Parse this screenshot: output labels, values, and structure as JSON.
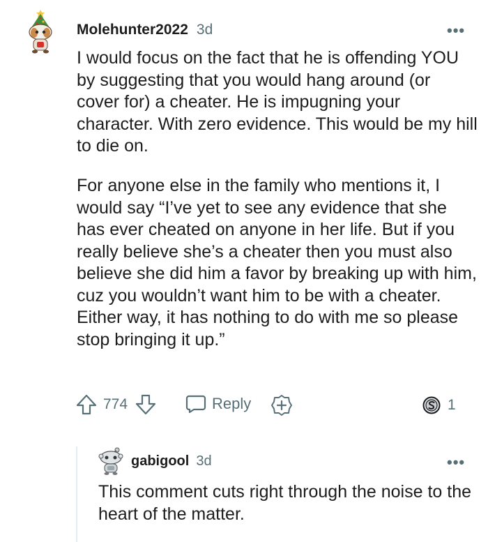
{
  "comment": {
    "username": "Molehunter2022",
    "age": "3d",
    "more_glyph": "•••",
    "paragraphs": [
      "I would focus on the fact that he is offending YOU by suggesting that you would hang around (or cover for) a cheater. He is impugning your character. With zero evidence. This would be my hill to die on.",
      "For anyone else in the family who mentions it, I would say “I’ve yet to see any evidence that she has ever cheated on anyone in her life. But if you really believe she’s a cheater then you must also believe she did him a favor by breaking up with him, cuz you wouldn’t want him to be with a cheater. Either way, it has nothing to do with me so please stop bringing it up.”"
    ],
    "score": "774",
    "reply_label": "Reply",
    "award_count": "1",
    "icons": {
      "avatar": "snoo-avatar-holiday",
      "upvote": "upvote-arrow-icon",
      "downvote": "downvote-arrow-icon",
      "reply": "speech-bubble-icon",
      "award": "add-award-icon",
      "coin": "award-coin-icon"
    }
  },
  "reply": {
    "username": "gabigool",
    "age": "3d",
    "more_glyph": "•••",
    "text": "This comment cuts right through the noise to the heart of the matter.",
    "icons": {
      "avatar": "snoo-avatar-gray"
    }
  },
  "colors": {
    "text": "#1c1c1c",
    "meta": "#576f76",
    "thread_line": "#e5ebee"
  }
}
